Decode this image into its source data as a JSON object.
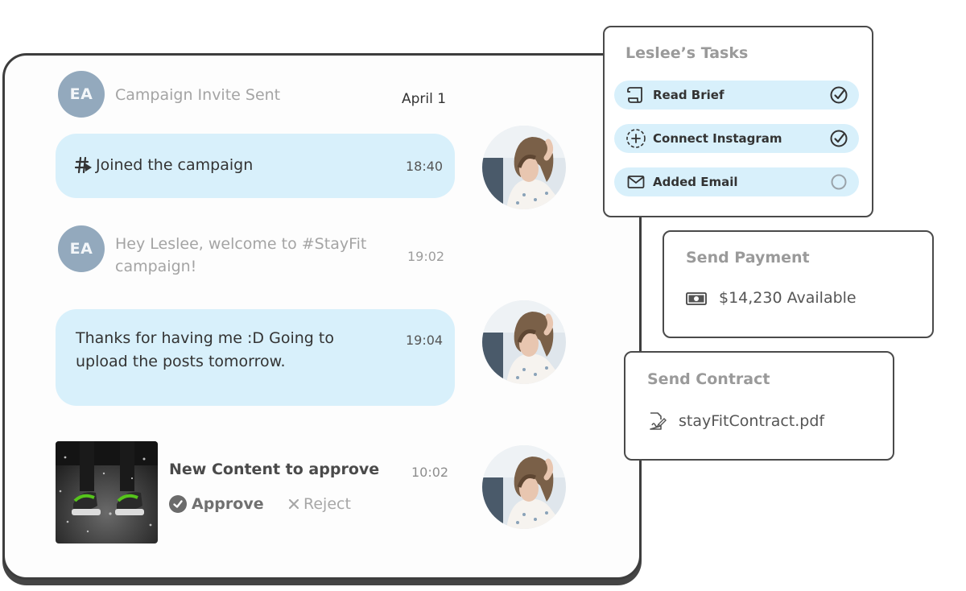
{
  "chat": {
    "invite": {
      "initials": "EA",
      "text": "Campaign Invite Sent",
      "date": "April 1"
    },
    "joined": {
      "text": "Joined the campaign",
      "time": "18:40",
      "icon": "hashtag-play-icon"
    },
    "welcome": {
      "initials": "EA",
      "line1": "Hey Leslee, welcome to #StayFit",
      "line2": "campaign!",
      "time": "19:02"
    },
    "reply": {
      "line1": "Thanks for having me :D Going to",
      "line2": "upload the posts tomorrow.",
      "time": "19:04"
    },
    "content": {
      "title": "New Content to approve",
      "time": "10:02",
      "approve_label": "Approve",
      "reject_label": "Reject"
    }
  },
  "tasks": {
    "title": "Leslee’s Tasks",
    "items": [
      {
        "label": "Read Brief",
        "icon": "scroll-icon",
        "done": true
      },
      {
        "label": "Connect Instagram",
        "icon": "plus-circle-icon",
        "done": true
      },
      {
        "label": "Added Email",
        "icon": "envelope-icon",
        "done": false
      }
    ]
  },
  "payment": {
    "title": "Send Payment",
    "amount": "$14,230 Available",
    "icon": "banknote-icon"
  },
  "contract": {
    "title": "Send Contract",
    "file": "stayFitContract.pdf",
    "icon": "file-signature-icon"
  },
  "colors": {
    "bubble": "#d8f0fb",
    "avatar": "#93a9bd",
    "border": "#3d3d3d"
  }
}
